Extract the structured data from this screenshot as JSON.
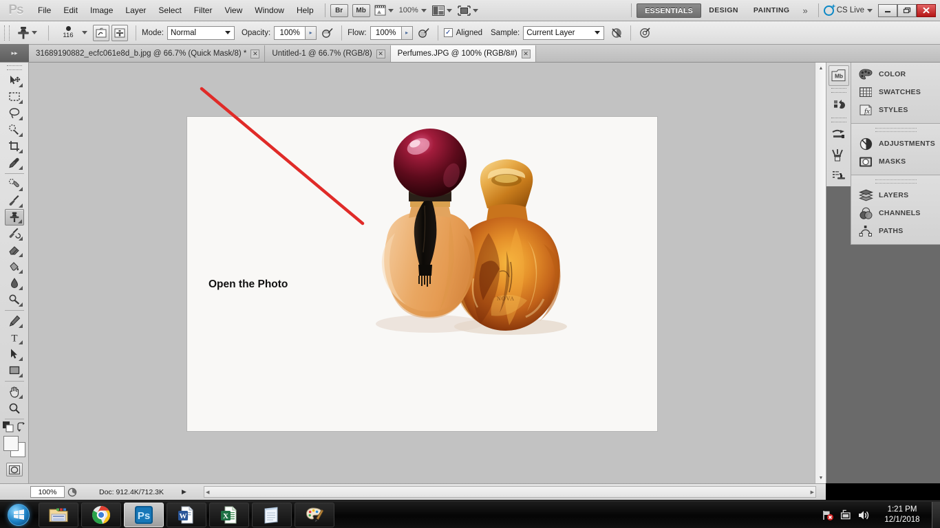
{
  "app": {
    "name": "Adobe Photoshop",
    "logo_text": "Ps"
  },
  "menubar": {
    "items": [
      "File",
      "Edit",
      "Image",
      "Layer",
      "Select",
      "Filter",
      "View",
      "Window",
      "Help"
    ],
    "bridge_label": "Br",
    "minibridge_label": "Mb",
    "zoom_level": "100%",
    "workspaces": [
      "ESSENTIALS",
      "DESIGN",
      "PAINTING"
    ],
    "active_workspace": "ESSENTIALS",
    "overflow_label": "»",
    "cslive_label": "CS Live",
    "window_buttons": {
      "minimize": "–",
      "restore": "❐",
      "close": "✕"
    }
  },
  "options_bar": {
    "tool": "clone-stamp",
    "brush_size": "116",
    "mode_label": "Mode:",
    "mode_value": "Normal",
    "opacity_label": "Opacity:",
    "opacity_value": "100%",
    "flow_label": "Flow:",
    "flow_value": "100%",
    "aligned_label": "Aligned",
    "aligned_checked": true,
    "aligned_mark": "✓",
    "sample_label": "Sample:",
    "sample_value": "Current Layer"
  },
  "tabs": [
    {
      "title": "31689190882_ecfc061e8d_b.jpg @ 66.7% (Quick Mask/8) *",
      "close": "✕",
      "active": false
    },
    {
      "title": "Untitled-1 @ 66.7% (RGB/8)",
      "close": "✕",
      "active": false
    },
    {
      "title": "Perfumes.JPG @ 100% (RGB/8#)",
      "close": "✕",
      "active": true
    }
  ],
  "toolbar": {
    "tools": [
      {
        "name": "move-tool",
        "selected": false
      },
      {
        "name": "rectangular-marquee-tool",
        "selected": false
      },
      {
        "name": "lasso-tool",
        "selected": false
      },
      {
        "name": "quick-selection-tool",
        "selected": false
      },
      {
        "name": "crop-tool",
        "selected": false
      },
      {
        "name": "eyedropper-tool",
        "selected": false
      },
      {
        "name": "spot-healing-brush-tool",
        "selected": false
      },
      {
        "name": "brush-tool",
        "selected": false
      },
      {
        "name": "clone-stamp-tool",
        "selected": true
      },
      {
        "name": "history-brush-tool",
        "selected": false
      },
      {
        "name": "eraser-tool",
        "selected": false
      },
      {
        "name": "paint-bucket-tool",
        "selected": false
      },
      {
        "name": "blur-tool",
        "selected": false
      },
      {
        "name": "dodge-tool",
        "selected": false
      },
      {
        "name": "pen-tool",
        "selected": false
      },
      {
        "name": "horizontal-type-tool",
        "selected": false
      },
      {
        "name": "path-selection-tool",
        "selected": false
      },
      {
        "name": "rectangle-tool",
        "selected": false
      },
      {
        "name": "hand-tool",
        "selected": false
      },
      {
        "name": "zoom-tool",
        "selected": false
      }
    ],
    "foreground_color": "#f7f7f7",
    "background_color": "#fdfdfd"
  },
  "canvas": {
    "caption": "Open the Photo",
    "background_color": "#f9f8f6",
    "annotation_color": "#e02b28",
    "document_background": "#c2c2c2",
    "image_subject": "two perfume bottles"
  },
  "status_bar": {
    "zoom": "100%",
    "doc_info": "Doc: 912.4K/712.3K",
    "arrow": "▶"
  },
  "dock": {
    "icon_column": [
      "mini-bridge-icon",
      "history-icon",
      "tool-presets-icon",
      "brush-presets-icon",
      "clone-source-icon"
    ],
    "minibridge_label": "Mb",
    "groups": [
      {
        "panels": [
          {
            "label": "COLOR",
            "icon": "color-palette-icon"
          },
          {
            "label": "SWATCHES",
            "icon": "swatches-grid-icon"
          },
          {
            "label": "STYLES",
            "icon": "styles-fx-icon"
          }
        ]
      },
      {
        "panels": [
          {
            "label": "ADJUSTMENTS",
            "icon": "adjustments-circle-icon"
          },
          {
            "label": "MASKS",
            "icon": "masks-icon"
          }
        ]
      },
      {
        "panels": [
          {
            "label": "LAYERS",
            "icon": "layers-stack-icon"
          },
          {
            "label": "CHANNELS",
            "icon": "channels-icon"
          },
          {
            "label": "PATHS",
            "icon": "paths-icon"
          }
        ]
      }
    ]
  },
  "taskbar": {
    "start_label": "Start",
    "items": [
      {
        "name": "windows-explorer",
        "icon": "folder-icon",
        "active": false
      },
      {
        "name": "google-chrome",
        "icon": "chrome-icon",
        "active": false
      },
      {
        "name": "adobe-photoshop",
        "icon": "photoshop-icon",
        "active": true
      },
      {
        "name": "microsoft-word",
        "icon": "word-icon",
        "active": false
      },
      {
        "name": "microsoft-excel",
        "icon": "excel-icon",
        "active": false
      },
      {
        "name": "notepad",
        "icon": "notepad-icon",
        "active": false
      },
      {
        "name": "paint",
        "icon": "paint-icon",
        "active": false
      }
    ],
    "tray": [
      "network-error-icon",
      "action-center-icon",
      "volume-icon"
    ],
    "clock_time": "1:21 PM",
    "clock_date": "12/1/2018"
  }
}
